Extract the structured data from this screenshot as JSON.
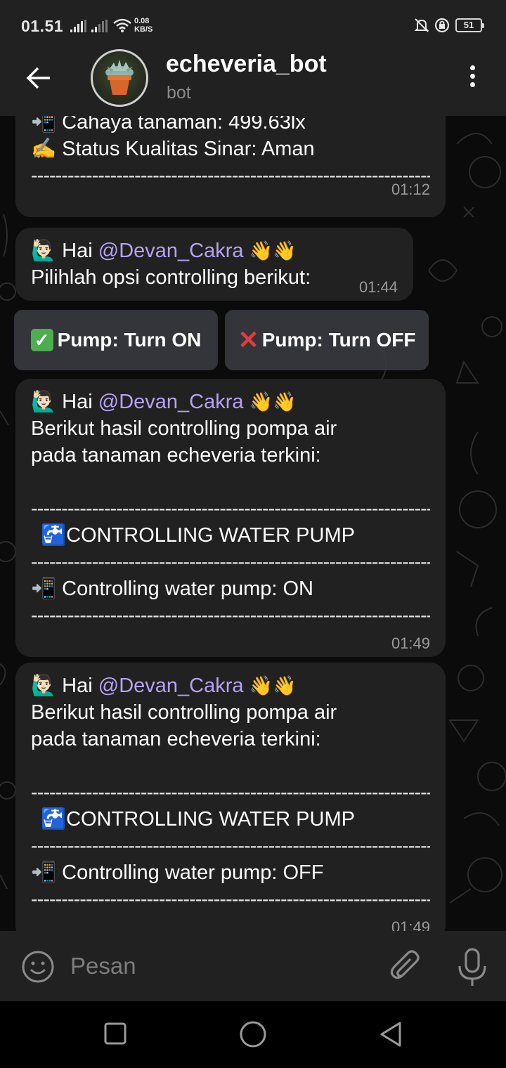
{
  "status_bar": {
    "time": "01.51",
    "net_speed_value": "0.08",
    "net_speed_unit": "KB/S",
    "battery": "51"
  },
  "header": {
    "title": "echeveria_bot",
    "subtitle": "bot"
  },
  "messages": [
    {
      "lines": [
        "📲 Cahaya tanaman: 499.63lx",
        "✍️ Status Kualitas Sinar: Aman"
      ],
      "divider": "------------------------------------------------------------------",
      "time": "01:12"
    },
    {
      "greeting": "🙋🏻‍♂️ Hai",
      "mention": "@Devan_Cakra",
      "wave": "👋👋",
      "text": "Pilihlah opsi controlling berikut:",
      "time": "01:44"
    },
    {
      "greeting": "🙋🏻‍♂️ Hai",
      "mention": "@Devan_Cakra",
      "wave": "👋👋",
      "text_lines": [
        "Berikut hasil controlling pompa air",
        "pada tanaman echeveria terkini:"
      ],
      "divider": "------------------------------------------------------------------",
      "heading": "🚰CONTROLLING WATER PUMP",
      "status": "📲 Controlling water pump: ON",
      "time": "01:49"
    },
    {
      "greeting": "🙋🏻‍♂️ Hai",
      "mention": "@Devan_Cakra",
      "wave": "👋👋",
      "text_lines": [
        "Berikut hasil controlling pompa air",
        "pada tanaman echeveria terkini:"
      ],
      "divider": "------------------------------------------------------------------",
      "heading": "🚰CONTROLLING WATER PUMP",
      "status": "📲 Controlling water pump: OFF",
      "time": "01:49"
    }
  ],
  "keyboard": {
    "pump_on": "Pump: Turn ON",
    "pump_off": "Pump: Turn OFF"
  },
  "input": {
    "placeholder": "Pesan"
  },
  "colors": {
    "header_bg": "#212121",
    "bubble_bg": "#212121",
    "chat_bg": "#0b0b0b",
    "mention": "#b5a2f2",
    "check_green": "#4cae4f",
    "cross_red": "#e93a3a"
  }
}
